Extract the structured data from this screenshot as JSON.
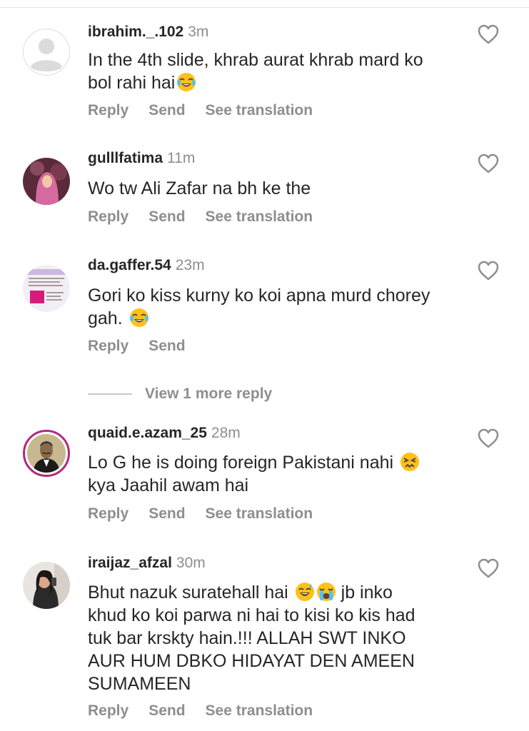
{
  "comments": [
    {
      "username": "ibrahim._.102",
      "time": "3m",
      "text_lines": [
        "In the 4th slide,  khrab aurat khrab mard ko",
        "bol rahi hai"
      ],
      "emojis": [
        "face-with-tears-of-joy"
      ],
      "actions": [
        "Reply",
        "Send",
        "See translation"
      ],
      "avatar": "default-avatar-icon"
    },
    {
      "username": "gulllfatima",
      "time": "11m",
      "text_lines": [
        "Wo tw Ali Zafar na bh ke the"
      ],
      "actions": [
        "Reply",
        "Send",
        "See translation"
      ],
      "avatar": "profile-photo"
    },
    {
      "username": "da.gaffer.54",
      "time": "23m",
      "text_lines": [
        "Gori ko kiss kurny ko koi apna murd chorey",
        "gah."
      ],
      "emojis": [
        "face-with-tears-of-joy"
      ],
      "actions": [
        "Reply",
        "Send"
      ],
      "avatar": "profile-photo"
    },
    {
      "username": "quaid.e.azam_25",
      "time": "28m",
      "text_lines": [
        "Lo G he is doing foreign Pakistani nahi",
        "kya Jaahil awam hai"
      ],
      "emojis": [
        "persevering-face"
      ],
      "actions": [
        "Reply",
        "Send",
        "See translation"
      ],
      "avatar": "profile-photo"
    },
    {
      "username": "iraijaz_afzal",
      "time": "30m",
      "text_lines": [
        "Bhut nazuk suratehall hai",
        "khud ko koi parwa ni hai to kisi ko kis had",
        "tuk bar krskty hain.!!! ALLAH SWT INKO",
        "AUR HUM DBKO HIDAYAT DEN AMEEN",
        "SUMAMEEN"
      ],
      "text_line1_tail": "jb inko",
      "emojis": [
        "grinning-face-with-sweat",
        "loudly-crying-face"
      ],
      "actions": [
        "Reply",
        "Send",
        "See translation"
      ],
      "avatar": "profile-photo"
    }
  ],
  "view_more_replies": "View 1 more reply",
  "colors": {
    "text": "#262626",
    "secondary": "#8e8e8e",
    "story_ring": "#b1297d"
  },
  "icons": [
    "heart-outline-icon"
  ]
}
